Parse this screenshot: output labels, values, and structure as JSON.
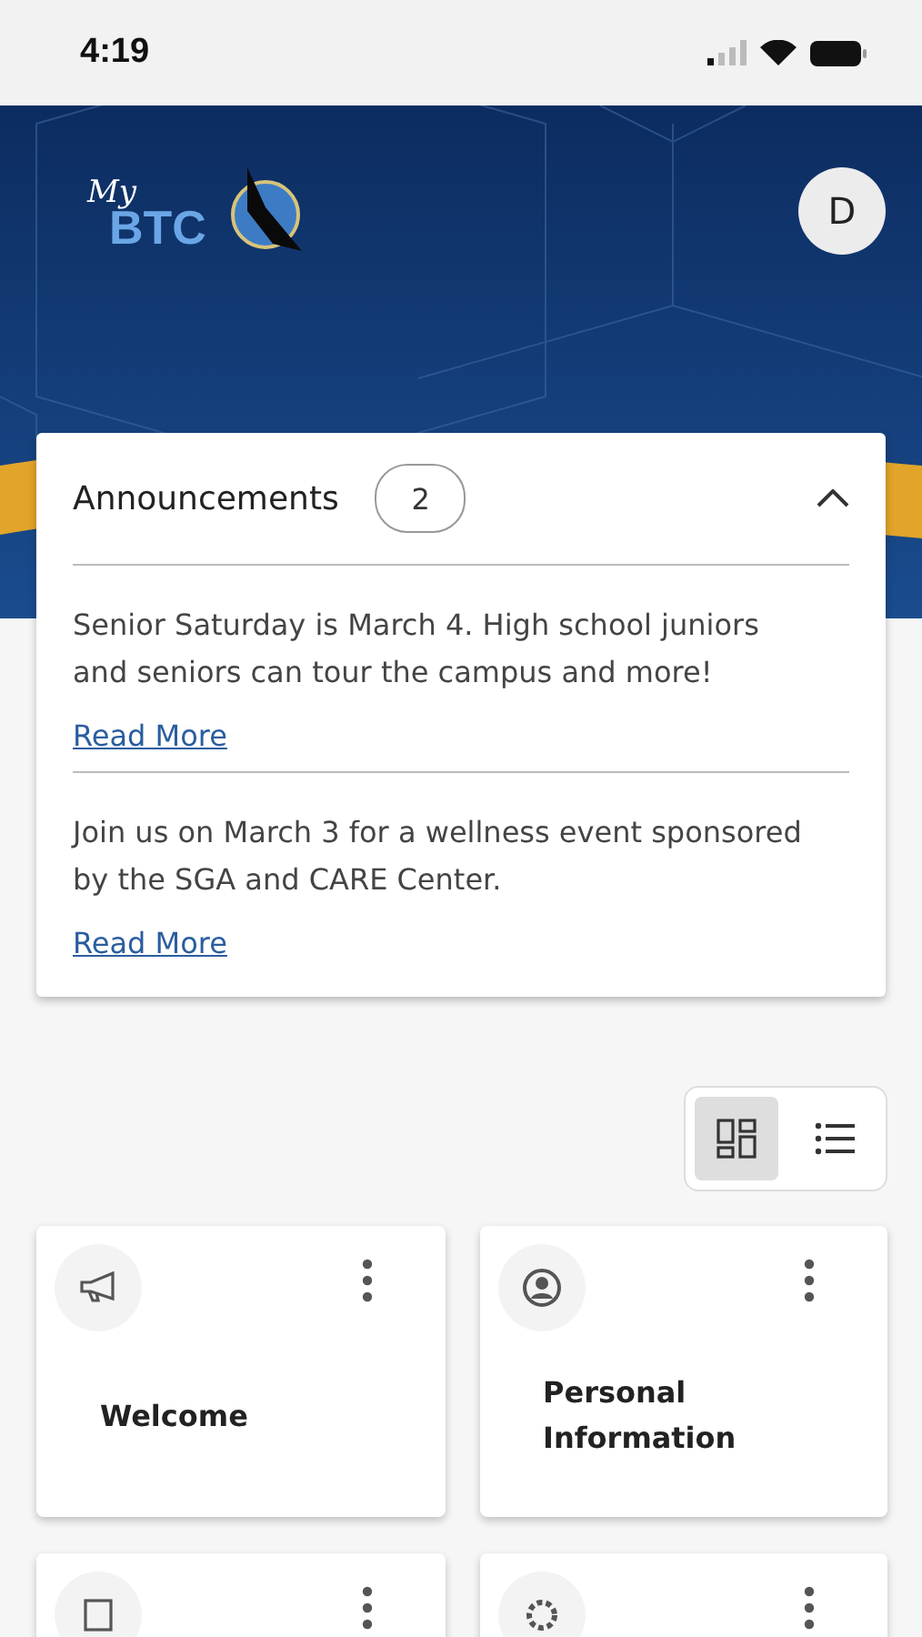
{
  "status_bar": {
    "time": "4:19"
  },
  "header": {
    "logo_top": "My",
    "logo_main": "BTC",
    "avatar": "D"
  },
  "announcements": {
    "title": "Announcements",
    "count": "2",
    "expanded": true,
    "items": [
      {
        "text": "Senior Saturday is March 4. High school juniors and seniors can tour the campus and more!",
        "link": "Read More"
      },
      {
        "text": "Join us on March 3 for a wellness event sponsored by the SGA and CARE Center.",
        "link": "Read More"
      }
    ]
  },
  "view_toggle": [
    {
      "kind": "grid",
      "selected": true
    },
    {
      "kind": "list",
      "selected": false
    }
  ],
  "tiles": [
    {
      "kind": "titled",
      "title": "Welcome"
    },
    {
      "kind": "titled",
      "title": "Personal Information"
    },
    {
      "kind": "cut"
    },
    {
      "kind": "cut"
    }
  ]
}
